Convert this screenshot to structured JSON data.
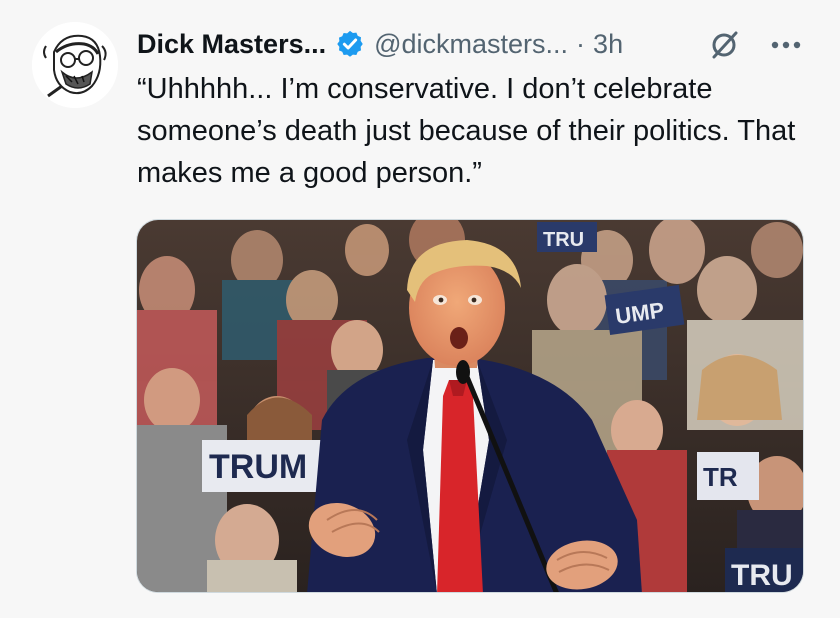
{
  "author": {
    "name": "Dick Masters...",
    "handle": "@dickmasters...",
    "separator": "·",
    "time": "3h"
  },
  "tweet": {
    "text": "“Uhhhhh... I’m conservative. I don’t celebrate someone’s death just because of their politics. That makes me a good person.”"
  },
  "media": {
    "sign_1": "TRUM",
    "sign_2": "UMP",
    "sign_3": "TRU",
    "sign_4": "TR",
    "sign_5": "TRU"
  },
  "icons": {
    "verified": "verified-badge-icon",
    "grok": "grok-icon",
    "more": "more-icon"
  },
  "colors": {
    "verified_blue": "#1d9bf0",
    "secondary_text": "#536471",
    "primary_text": "#0f1419"
  }
}
